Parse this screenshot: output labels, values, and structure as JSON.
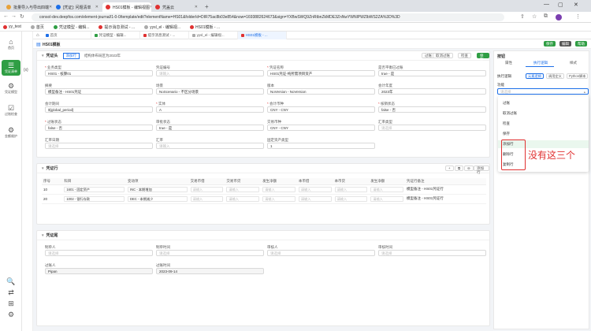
{
  "browser": {
    "tabs": [
      {
        "label": "批量导入与导出四端",
        "color": "#e8a23a"
      },
      {
        "label": "[凭证]: 问题清单",
        "color": "#1d6fe8"
      },
      {
        "label": "HS01模板 - 编辑视图",
        "color": "#e03131",
        "active": true
      },
      {
        "label": "凭盖云",
        "color": "#e03131"
      }
    ],
    "url": "consol-dev.deepfos.com/element-journal/1-0-0/template/edit?elementName=HS01&folderId=DIR75ac8b03e854&now=1693882624673&sign=YXBwSWQ9ZnRtbnZkMDE3ZnNwYWNlPWZlbWS2ZA%3D%3D",
    "bookmarks": [
      {
        "label": "yy_test",
        "color": "#e03131"
      },
      {
        "label": "首页",
        "color": "#aaa"
      },
      {
        "label": "凭证模型 - 编辑...",
        "color": "#2f9e44"
      },
      {
        "label": "提示消息测试 - ...",
        "color": "#e03131"
      },
      {
        "label": "yysl_el - 编辑视...",
        "color": "#aaa"
      },
      {
        "label": "HS01模板 - ...",
        "color": "#e03131"
      }
    ]
  },
  "nav": {
    "items": [
      {
        "label": "首页",
        "icon": "⌂"
      },
      {
        "label": "凭证清单",
        "icon": "☰",
        "active": true
      },
      {
        "label": "凭证模型",
        "icon": "⚙"
      },
      {
        "label": "过账检查",
        "icon": "☑"
      },
      {
        "label": "金额维护",
        "icon": "⚙"
      }
    ],
    "bottom_icons": [
      "🔍",
      "⇄",
      "⊞",
      "⚙"
    ]
  },
  "sidebar2_icon": "{x}",
  "app_tabs": [
    {
      "label": "首页",
      "color": "#1d6fe8"
    },
    {
      "label": "凭证模型 - 编辑...",
      "color": "#2f9e44"
    },
    {
      "label": "提示消息测试 - ...",
      "color": "#e03131"
    },
    {
      "label": "yysl_el - 编辑视...",
      "color": "#aaa"
    },
    {
      "label": "HS01模板 - ...",
      "color": "#e03131",
      "active": true
    }
  ],
  "title_bar": {
    "title": "HS01模板",
    "save": "保存",
    "edit": "编辑",
    "help": "帮助"
  },
  "header_card": {
    "title": "凭证头",
    "tag": "添加行",
    "subtitle": "结构体布局区为2023年",
    "actions": [
      "过账",
      "取消过账",
      "检查",
      "保存"
    ],
    "fields": [
      {
        "label": "业务类型",
        "value": "HS01 - 核算01",
        "req": true
      },
      {
        "label": "凭证编号",
        "value": "请输入",
        "ph": true
      },
      {
        "label": "凭证名称",
        "value": "HS01凭证-纯所需项目资产",
        "req": true
      },
      {
        "label": "是否平衡已过账",
        "value": "true - 是"
      },
      {
        "label": "摘要",
        "value": "模型备注 - HS01凭证"
      },
      {
        "label": "场景",
        "value": "NoScenario - 不区分场景"
      },
      {
        "label": "版本",
        "value": "NoVersion - NoVersion"
      },
      {
        "label": "会计年度",
        "value": "2023年"
      },
      {
        "label": "会计期间",
        "value": "${global_period}"
      },
      {
        "label": "实体",
        "value": "A",
        "req": true
      },
      {
        "label": "会计币种",
        "value": "CNY - CNY",
        "req": true
      },
      {
        "label": "核销状态",
        "value": "false - 否",
        "req": true
      },
      {
        "label": "过账状态",
        "value": "false - 否",
        "req": true
      },
      {
        "label": "审批状态",
        "value": "true - 是"
      },
      {
        "label": "交易币种",
        "value": "CNY - CNY"
      },
      {
        "label": "汇率类型",
        "value": "请选择",
        "ph": true
      },
      {
        "label": "汇率日期",
        "value": "请选择",
        "ph": true
      },
      {
        "label": "汇率",
        "value": "请输入",
        "ph": true
      },
      {
        "label": "固定资产类型",
        "value": "1"
      }
    ]
  },
  "lines_card": {
    "title": "凭证行",
    "add": "添加行",
    "columns": [
      "序号",
      "科目",
      "变动项",
      "交易币借",
      "交易币贷",
      "发生净额",
      "本币借",
      "本币贷",
      "发生净额",
      "凭证行备注"
    ],
    "rows": [
      {
        "seq": "10",
        "account": "1601 - 固定资产",
        "movement": "INC - 本期增加",
        "note": "模型备注 - HS01凭证行"
      },
      {
        "seq": "20",
        "account": "1002 - 银行存款",
        "movement": "DEC - 本期减少",
        "note": "模型备注 - HS01凭证行"
      }
    ],
    "cell_placeholder": "请输入"
  },
  "audit_card": {
    "title": "凭证尾",
    "fields": [
      {
        "label": "制单人",
        "value": "请选择",
        "ph": true
      },
      {
        "label": "制单时间",
        "value": "请选择",
        "ph": true
      },
      {
        "label": "审核人",
        "value": "请选择",
        "ph": true
      },
      {
        "label": "审核时间",
        "value": "请选择",
        "ph": true
      },
      {
        "label": "过账人",
        "value": "Pipan"
      },
      {
        "label": "过账时间",
        "value": "2023-09-14"
      }
    ]
  },
  "right_panel": {
    "header": "按钮",
    "tabs": [
      "属性",
      "执行逻辑",
      "样式"
    ],
    "logic_label": "执行逻辑",
    "logic_buttons": [
      "元素逻辑",
      "调用定义",
      "Python脚本"
    ],
    "func_label": "功能",
    "func_placeholder": "请选择",
    "options": [
      "过账",
      "取消过账",
      "检查",
      "保存",
      "添加行",
      "删除行",
      "复制行"
    ]
  },
  "annotation": "没有这三个"
}
